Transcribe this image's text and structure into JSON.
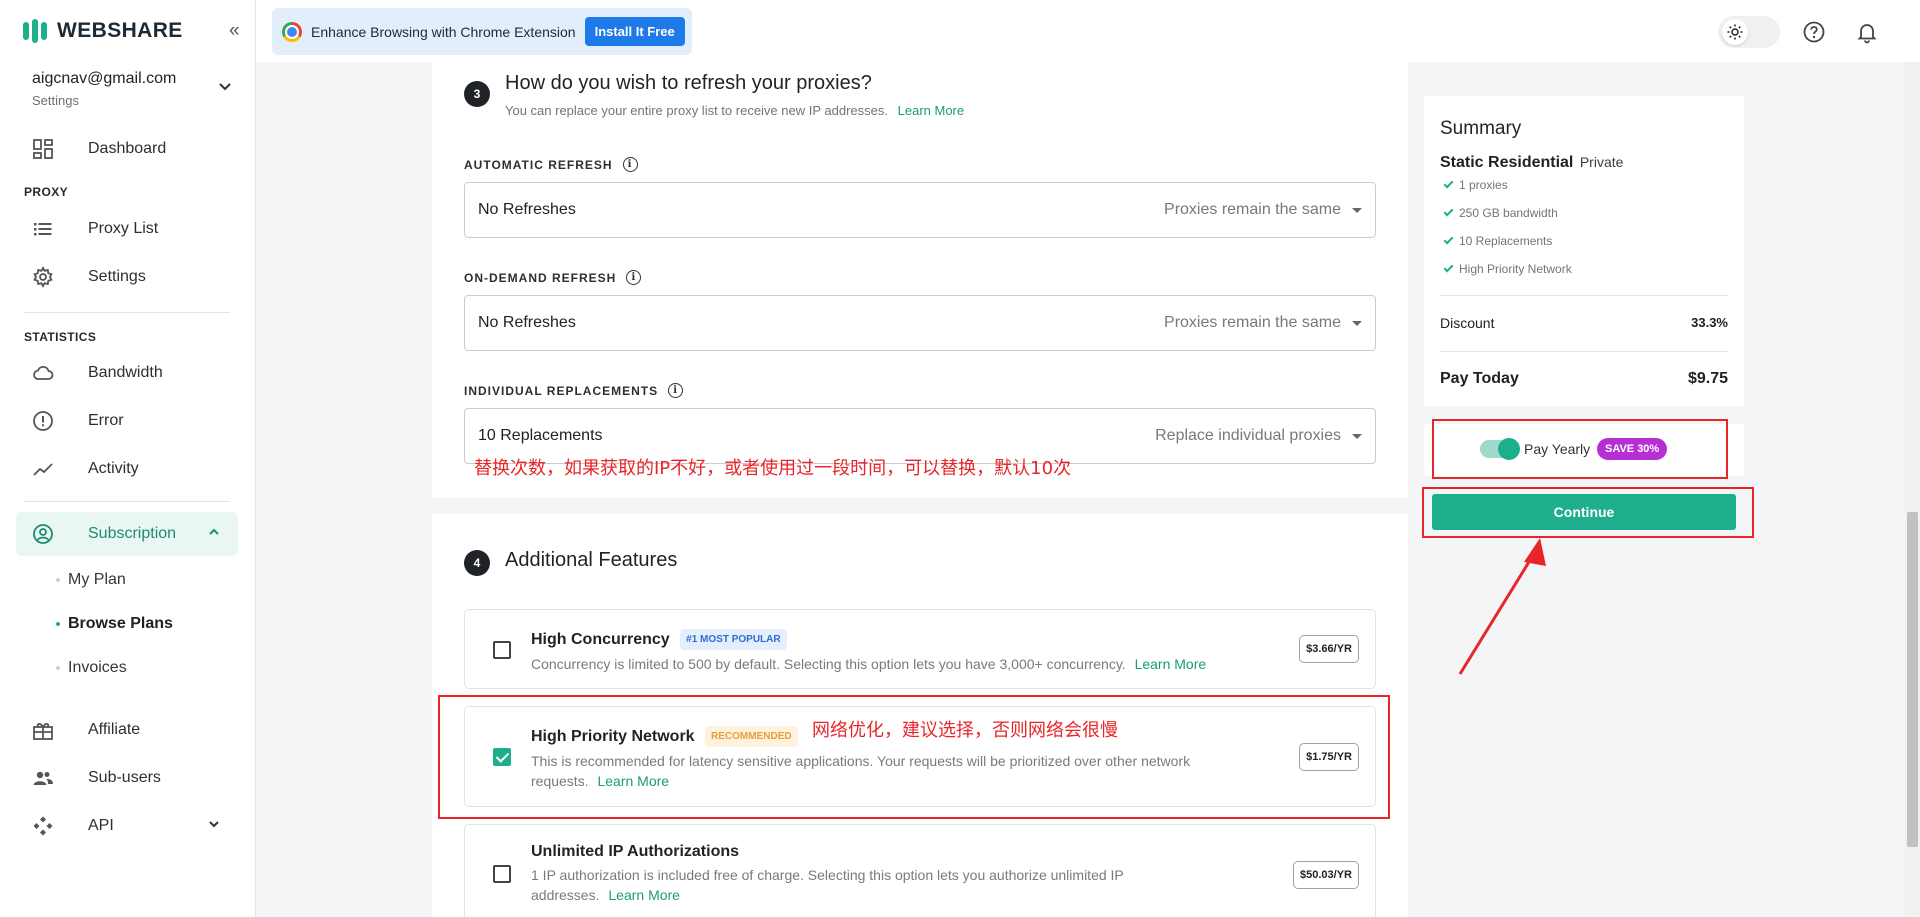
{
  "brand": {
    "name": "WEBSHARE",
    "accent": "#1fae8c",
    "icon": "webshare-logo"
  },
  "sidebar": {
    "collapse_glyph": "«",
    "account": {
      "email": "aigcnav@gmail.com",
      "subtitle": "Settings"
    },
    "items": {
      "dashboard": {
        "label": "Dashboard",
        "icon": "dashboard-icon"
      },
      "proxy_section": "PROXY",
      "proxy_list": {
        "label": "Proxy List",
        "icon": "list-icon"
      },
      "settings": {
        "label": "Settings",
        "icon": "gear-icon"
      },
      "statistics_section": "STATISTICS",
      "bandwidth": {
        "label": "Bandwidth",
        "icon": "cloud-icon"
      },
      "error": {
        "label": "Error",
        "icon": "alert-circle-icon"
      },
      "activity": {
        "label": "Activity",
        "icon": "trend-icon"
      },
      "subscription": {
        "label": "Subscription",
        "icon": "account-circle-icon"
      },
      "my_plan": "My Plan",
      "browse_plans": "Browse Plans",
      "invoices": "Invoices",
      "affiliate": {
        "label": "Affiliate",
        "icon": "gift-icon"
      },
      "sub_users": {
        "label": "Sub-users",
        "icon": "users-icon"
      },
      "api": {
        "label": "API",
        "icon": "api-icon"
      }
    }
  },
  "topbar": {
    "extension_text": "Enhance Browsing with Chrome Extension",
    "install_label": "Install It Free",
    "icons": [
      "sun-icon",
      "help-icon",
      "bell-icon"
    ]
  },
  "step3": {
    "number": "3",
    "title": "How do you wish to refresh your proxies?",
    "description": "You can replace your entire proxy list to receive new IP addresses.",
    "learn_more": "Learn More",
    "automatic_refresh": {
      "label": "AUTOMATIC REFRESH",
      "value": "No Refreshes",
      "hint": "Proxies remain the same"
    },
    "on_demand_refresh": {
      "label": "ON-DEMAND REFRESH",
      "value": "No Refreshes",
      "hint": "Proxies remain the same"
    },
    "individual_replacements": {
      "label": "INDIVIDUAL REPLACEMENTS",
      "value": "10 Replacements",
      "hint": "Replace individual proxies"
    }
  },
  "step4": {
    "number": "4",
    "title": "Additional Features",
    "features": [
      {
        "title": "High Concurrency",
        "badge": "#1 MOST POPULAR",
        "description": "Concurrency is limited to 500 by default. Selecting this option lets you have 3,000+ concurrency.",
        "learn_more": "Learn More",
        "price": "$3.66/YR",
        "checked": false
      },
      {
        "title": "High Priority Network",
        "badge": "RECOMMENDED",
        "description": "This is recommended for latency sensitive applications. Your requests will be prioritized over other network requests.",
        "learn_more": "Learn More",
        "price": "$1.75/YR",
        "checked": true
      },
      {
        "title": "Unlimited IP Authorizations",
        "badge": "",
        "description": "1 IP authorization is included free of charge. Selecting this option lets you authorize unlimited IP addresses.",
        "learn_more": "Learn More",
        "price": "$50.03/YR",
        "checked": false
      }
    ]
  },
  "summary": {
    "title": "Summary",
    "plan_name": "Static Residential",
    "plan_type": "Private",
    "features": [
      "1 proxies",
      "250 GB bandwidth",
      "10 Replacements",
      "High Priority Network"
    ],
    "discount_label": "Discount",
    "discount_value": "33.3%",
    "pay_today_label": "Pay Today",
    "pay_today_value": "$9.75",
    "pay_yearly_label": "Pay Yearly",
    "pay_yearly_on": true,
    "save_badge": "SAVE 30%",
    "continue_label": "Continue"
  },
  "annotations": {
    "replacements_note": "替换次数，如果获取的IP不好，或者使用过一段时间，可以替换，默认10次",
    "priority_note": "网络优化，建议选择，否则网络会很慢",
    "color": "#e8262a"
  }
}
